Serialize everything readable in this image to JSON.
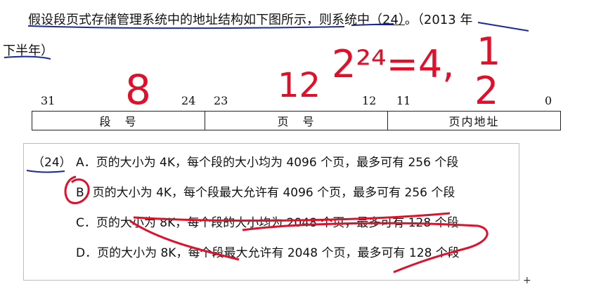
{
  "question": {
    "line1_prefix": "假设段页式存储管理系统中的地址结构如下图所示，则系统中",
    "blank": "（24）",
    "line1_suffix": "。（2013 年",
    "line2": "下半年）"
  },
  "address_structure": {
    "bit_labels": [
      "31",
      "24",
      "23",
      "12",
      "11",
      "0"
    ],
    "fields": [
      "段　号",
      "页　号",
      "页内地址"
    ]
  },
  "options": {
    "number": "（24）",
    "A": "A．页的大小为 4K，每个段的大小均为 4096 个页，最多可有 256 个段",
    "B_letter": "B",
    "B_text": "页的大小为 4K，每个段最大允许有 4096 个页，最多可有 256 个段",
    "C": "C．页的大小为 8K，每个段的大小均为 2048 个页，最多可有 128 个段",
    "D": "D．页的大小为 8K，每个段最大允许有 2048 个页，最多可有 128 个段"
  },
  "annotations": {
    "segment_bits": "8",
    "page_bits": "12",
    "calc": "2²⁴=4,",
    "frac_top": "1",
    "frac_bottom": "2",
    "ink_color": "#e0102a",
    "pen_color": "#1a2a9a"
  }
}
